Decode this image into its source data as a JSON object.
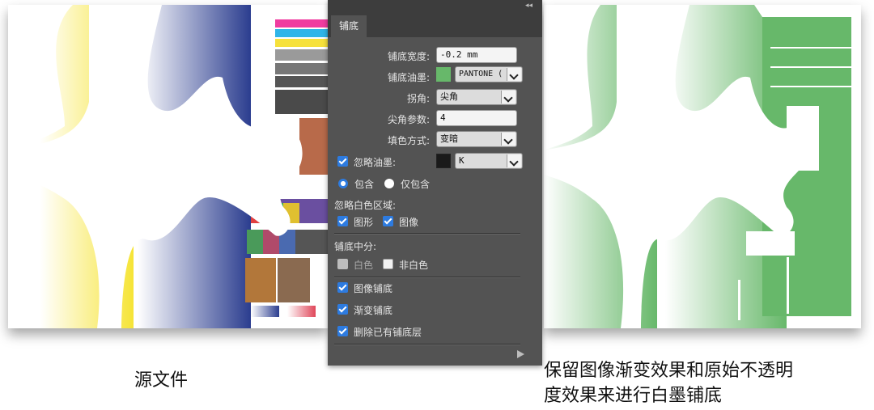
{
  "panel": {
    "tab": "铺底",
    "fields": {
      "width_label": "铺底宽度:",
      "width_value": "-0.2 mm",
      "ink_label": "铺底油墨:",
      "ink_value": "PANTONE (",
      "ink_color": "#67b86a",
      "corner_label": "拐角:",
      "corner_value": "尖角",
      "miter_label": "尖角参数:",
      "miter_value": "4",
      "fill_label": "填色方式:",
      "fill_value": "变暗"
    },
    "ignore_ink_label": "忽略油墨:",
    "ignore_ink_value": "K",
    "ignore_ink_color": "#1a1a1a",
    "radio_include": "包含",
    "radio_only": "仅包含",
    "ignore_white_label": "忽略白色区域:",
    "graphic_label": "图形",
    "image_label": "图像",
    "middle_label": "铺底中分:",
    "white_label": "白色",
    "nonwhite_label": "非白色",
    "image_underlay_label": "图像铺底",
    "gradient_underlay_label": "渐变铺底",
    "delete_existing_label": "删除已有铺底层"
  },
  "captions": {
    "left": "源文件",
    "right_line1": "保留图像渐变效果和原始不透明",
    "right_line2": "度效果来进行白墨铺底"
  },
  "colors": {
    "panel_bg": "#535353",
    "checkbox_blue": "#2d7be0",
    "underlay_green": "#67b86a"
  }
}
